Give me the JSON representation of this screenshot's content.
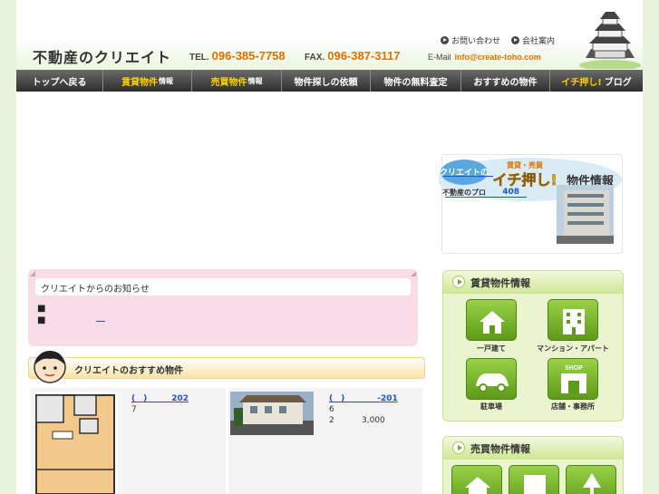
{
  "header": {
    "logo_text": "不動産のクリエイト",
    "tel_label": "TEL.",
    "tel": "096-385-7758",
    "fax_label": "FAX.",
    "fax": "096-387-3117",
    "email_label": "E-Mail",
    "email": "info@create-toho.com",
    "contact_link": "お問い合わせ",
    "company_link": "会社案内"
  },
  "nav": {
    "items": [
      {
        "label": "トップへ戻る"
      },
      {
        "label_hl": "賃貸物件",
        "label_sm": "情報"
      },
      {
        "label_hl": "売買物件",
        "label_sm": "情報"
      },
      {
        "label": "物件探しの依頼"
      },
      {
        "label": "物件の無料査定"
      },
      {
        "label": "おすすめの物件"
      },
      {
        "label_hl": "イチ押し!",
        "label": "ブログ"
      }
    ]
  },
  "notice": {
    "title": "クリエイトからのお知らせ",
    "items": [
      "■",
      "■"
    ]
  },
  "recommended": {
    "title": "クリエイトのおすすめ物件",
    "cards": [
      {
        "link": "(　)　　　202",
        "line1": "7",
        "line2": ""
      },
      {
        "link": "(　)　　　　-201",
        "line1": "6",
        "line2": "2",
        "price": "3,000"
      }
    ]
  },
  "ichioshi": {
    "tag": "クリエイトの",
    "sub": "不動産のプロ",
    "badge_small": "賃貸・売買",
    "badge_big": "イチ押し!",
    "badge_tail": "物件情報",
    "link2": "408"
  },
  "rental_panel": {
    "title": "賃貸物件情報",
    "tiles": [
      "一戸建て",
      "マンション・アパート",
      "駐車場",
      "店舗・事務所"
    ],
    "shop_sign": "SHOP"
  },
  "sale_panel": {
    "title": "売買物件情報"
  },
  "colors": {
    "accent_orange": "#e07000",
    "nav_dark": "#3a3a3a",
    "nav_highlight": "#ffd000",
    "green_tile": "#5d9a18",
    "notice_pink": "#f8dde9"
  }
}
